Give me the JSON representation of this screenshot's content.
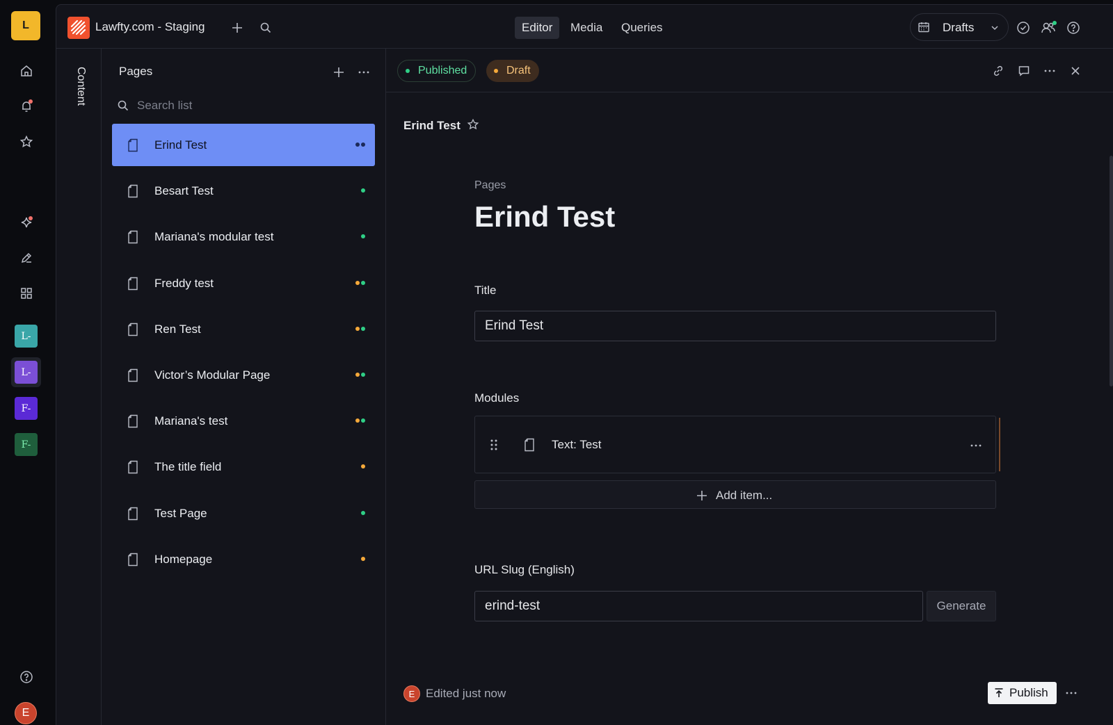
{
  "rail": {
    "user_initial": "L",
    "workspaces": [
      {
        "label": "L-",
        "bg": "#3aa6a8",
        "fg": "#ffffff"
      },
      {
        "label": "L-",
        "bg": "#7b4fd6",
        "fg": "#ffffff"
      },
      {
        "label": "F-",
        "bg": "#5b2ad6",
        "fg": "#ffffff"
      },
      {
        "label": "F-",
        "bg": "#1f5e3c",
        "fg": "#7ff0b0"
      }
    ],
    "avatar_initial": "E"
  },
  "topbar": {
    "project_name": "Lawfty.com - Staging",
    "nav": [
      "Editor",
      "Media",
      "Queries"
    ],
    "perspective": "Drafts"
  },
  "sidebar": {
    "vertical_tab": "Content",
    "title": "Pages",
    "search_placeholder": "Search list",
    "items": [
      {
        "label": "Erind Test",
        "status": [
          "#8a8fa3",
          "#8a8fa3"
        ]
      },
      {
        "label": "Besart Test",
        "status": [
          "#2fcf86"
        ]
      },
      {
        "label": "Mariana's modular test",
        "status": [
          "#2fcf86"
        ]
      },
      {
        "label": "Freddy test",
        "status": [
          "#f5a93a",
          "#2fcf86"
        ]
      },
      {
        "label": "Ren Test",
        "status": [
          "#f5a93a",
          "#2fcf86"
        ]
      },
      {
        "label": "Victor’s Modular Page",
        "status": [
          "#f5a93a",
          "#2fcf86"
        ]
      },
      {
        "label": "Mariana's test",
        "status": [
          "#f5a93a",
          "#2fcf86"
        ]
      },
      {
        "label": "The title field",
        "status": [
          "#f5a93a"
        ]
      },
      {
        "label": "Test Page",
        "status": [
          "#2fcf86"
        ]
      },
      {
        "label": "Homepage",
        "status": [
          "#f5a93a"
        ]
      }
    ]
  },
  "editor": {
    "badges": {
      "published": "Published",
      "draft": "Draft"
    },
    "doc_title_small": "Erind Test",
    "breadcrumb": "Pages",
    "heading": "Erind Test",
    "title_label": "Title",
    "title_value": "Erind Test",
    "modules_label": "Modules",
    "module_item": "Text: Test",
    "add_item": "Add item...",
    "slug_label": "URL Slug (English)",
    "slug_value": "erind-test",
    "generate": "Generate",
    "footer_status": "Edited just now",
    "footer_avatar": "E",
    "publish": "Publish"
  },
  "colors": {
    "accent": "#6e8ef5",
    "published": "#2fcf86",
    "draft": "#f5a93a",
    "brand_logo": "#f0512e"
  }
}
